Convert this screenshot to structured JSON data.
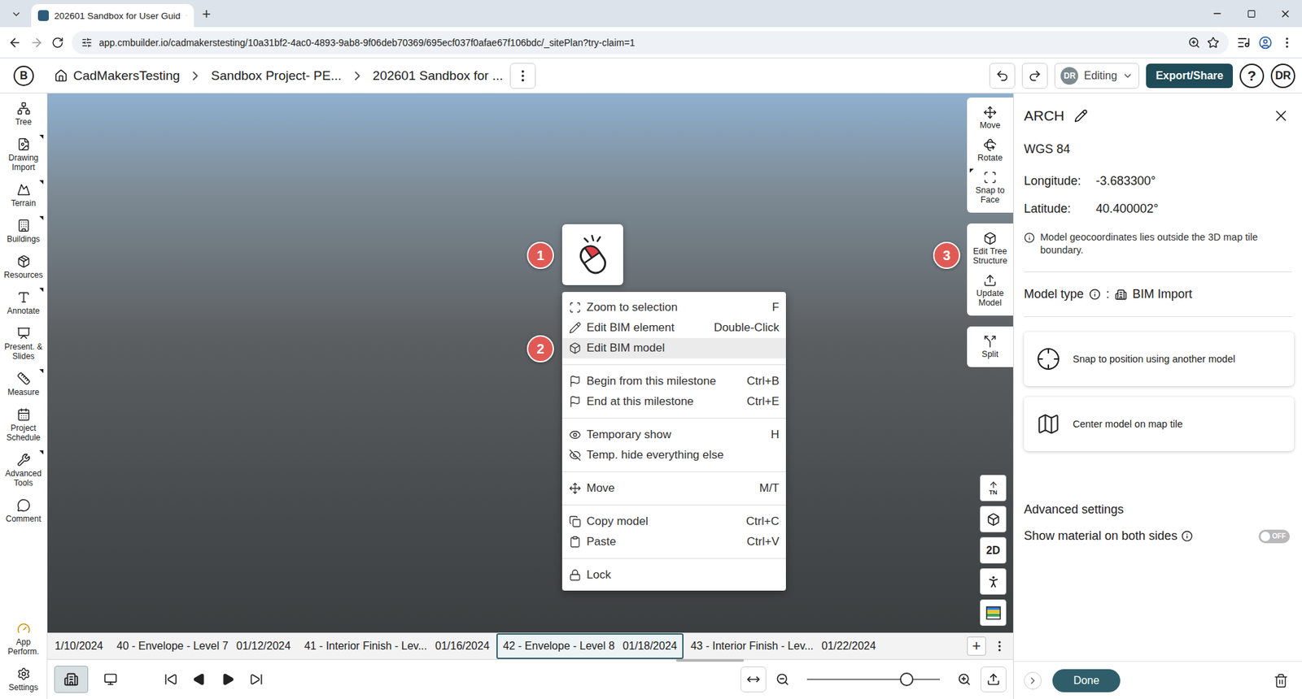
{
  "browser": {
    "tab": {
      "title": "202601 Sandbox for User Guid",
      "selected": true
    },
    "new_tab": "+",
    "url": "app.cmbuilder.io/cadmakerstesting/10a31bf2-4ac0-4893-9ab8-9f06deb70369/695ecf037f0afae67f106bdc/_sitePlan?try-claim=1"
  },
  "header": {
    "logo": "B",
    "breadcrumbs": [
      "CadMakersTesting",
      "Sandbox Project- PE...",
      "202601 Sandbox for ..."
    ],
    "mode": {
      "avatar": "DR",
      "label": "Editing"
    },
    "export_button": "Export/Share",
    "help": "?",
    "user": "DR"
  },
  "sidebar": {
    "items": [
      {
        "label": "Tree",
        "submenu": false
      },
      {
        "label": "Drawing Import",
        "submenu": true
      },
      {
        "label": "Terrain",
        "submenu": true
      },
      {
        "label": "Buildings",
        "submenu": true
      },
      {
        "label": "Resources",
        "submenu": false
      },
      {
        "label": "Annotate",
        "submenu": true
      },
      {
        "label": "Present. & Slides",
        "submenu": false
      },
      {
        "label": "Measure",
        "submenu": true
      },
      {
        "label": "Project Schedule",
        "submenu": false
      },
      {
        "label": "Advanced Tools",
        "submenu": true
      },
      {
        "label": "Comment",
        "submenu": false
      }
    ],
    "bottom_items": [
      {
        "label": "App Perform."
      },
      {
        "label": "Settings"
      }
    ]
  },
  "toolbar": {
    "groups": [
      [
        {
          "label": "Move",
          "submenu": false
        },
        {
          "label": "Rotate",
          "submenu": false
        },
        {
          "label": "Snap to Face",
          "submenu": true
        }
      ],
      [
        {
          "label": "Edit Tree Structure",
          "submenu": false
        },
        {
          "label": "Update Model",
          "submenu": false
        }
      ],
      [
        {
          "label": "Split",
          "submenu": false
        }
      ]
    ]
  },
  "view_buttons": [
    {
      "kind": "north",
      "label": "TN"
    },
    {
      "kind": "cube"
    },
    {
      "kind": "text",
      "label": "2D"
    },
    {
      "kind": "person"
    },
    {
      "kind": "layers"
    }
  ],
  "context_menu": {
    "groups": [
      [
        {
          "label": "Zoom to selection",
          "shortcut": "F",
          "selected": false
        },
        {
          "label": "Edit BIM element",
          "shortcut": "Double-Click",
          "selected": false
        },
        {
          "label": "Edit BIM model",
          "shortcut": "",
          "selected": true
        }
      ],
      [
        {
          "label": "Begin from this milestone",
          "shortcut": "Ctrl+B",
          "selected": false
        },
        {
          "label": "End at this milestone",
          "shortcut": "Ctrl+E",
          "selected": false
        }
      ],
      [
        {
          "label": "Temporary show",
          "shortcut": "H",
          "selected": false
        },
        {
          "label": "Temp. hide everything else",
          "shortcut": "",
          "selected": false
        }
      ],
      [
        {
          "label": "Move",
          "shortcut": "M/T",
          "selected": false
        }
      ],
      [
        {
          "label": "Copy model",
          "shortcut": "Ctrl+C",
          "selected": false
        },
        {
          "label": "Paste",
          "shortcut": "Ctrl+V",
          "selected": false
        }
      ],
      [
        {
          "label": "Lock",
          "shortcut": "",
          "selected": false
        }
      ]
    ]
  },
  "callouts": [
    "1",
    "2",
    "3"
  ],
  "timeline": {
    "milestones": [
      {
        "date": "1/10/2024",
        "selected": false
      },
      {
        "label": "40 - Envelope - Level 7",
        "date": "01/12/2024",
        "selected": false
      },
      {
        "label": "41 - Interior Finish - Lev...",
        "date": "01/16/2024",
        "selected": false
      },
      {
        "label": "42 - Envelope - Level 8",
        "date": "01/18/2024",
        "selected": true
      },
      {
        "label": "43 - Interior Finish - Lev...",
        "date": "01/22/2024",
        "selected": false
      }
    ],
    "add": "+"
  },
  "playback": {
    "view_modes": [
      {
        "selected": true
      },
      {
        "selected": false
      }
    ],
    "zoom": {
      "level": 0.75
    }
  },
  "panel": {
    "title": "ARCH",
    "crs": "WGS 84",
    "coords": [
      {
        "label": "Longitude:",
        "value": "-3.683300°"
      },
      {
        "label": "Latitude:",
        "value": "40.400002°"
      }
    ],
    "notice": "Model geocoordinates lies outside the 3D map tile boundary.",
    "model_type": {
      "label": "Model type",
      "separator": ":",
      "value": "BIM Import"
    },
    "actions": [
      "Snap to position using another model",
      "Center model on map tile"
    ],
    "advanced": {
      "title": "Advanced settings",
      "options": [
        {
          "label": "Show material on both sides",
          "on": false,
          "state_label": "OFF"
        }
      ]
    },
    "done": "Done"
  }
}
